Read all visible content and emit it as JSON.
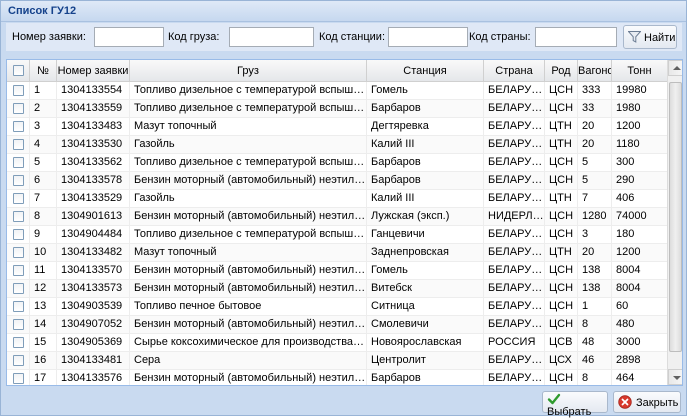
{
  "title": "Список ГУ12",
  "filter": {
    "request_label": "Номер заявки:",
    "cargo_label": "Код груза:",
    "station_label": "Код станции:",
    "country_label": "Код страны:",
    "request_value": "",
    "cargo_value": "",
    "station_value": "",
    "country_value": "",
    "find_label": "Найти",
    "find_icon": "funnel-icon"
  },
  "table": {
    "columns": [
      "№",
      "Номер заявки",
      "Груз",
      "Станция",
      "Страна",
      "Род",
      "Вагонов",
      "Тонн"
    ],
    "rows": [
      [
        "1",
        "1304133554",
        "Топливо дизельное с температурой вспышки вы…",
        "Гомель",
        "БЕЛАРУСЬ",
        "ЦСН",
        "333",
        "19980"
      ],
      [
        "2",
        "1304133559",
        "Топливо дизельное с температурой вспышки вы…",
        "Барбаров",
        "БЕЛАРУСЬ",
        "ЦСН",
        "33",
        "1980"
      ],
      [
        "3",
        "1304133483",
        "Мазут топочный",
        "Дегтяревка",
        "БЕЛАРУСЬ",
        "ЦТН",
        "20",
        "1200"
      ],
      [
        "4",
        "1304133530",
        "Газойль",
        "Калий III",
        "БЕЛАРУСЬ",
        "ЦТН",
        "20",
        "1180"
      ],
      [
        "5",
        "1304133562",
        "Топливо дизельное с температурой вспышки вы…",
        "Барбаров",
        "БЕЛАРУСЬ",
        "ЦСН",
        "5",
        "300"
      ],
      [
        "6",
        "1304133578",
        "Бензин моторный (автомобильный) неэтилирова…",
        "Барбаров",
        "БЕЛАРУСЬ",
        "ЦСН",
        "5",
        "290"
      ],
      [
        "7",
        "1304133529",
        "Газойль",
        "Калий III",
        "БЕЛАРУСЬ",
        "ЦТН",
        "7",
        "406"
      ],
      [
        "8",
        "1304901613",
        "Бензин моторный (автомобильный) неэтилирова…",
        "Лужская (эксп.)",
        "НИДЕРЛ…",
        "ЦСН",
        "1280",
        "74000"
      ],
      [
        "9",
        "1304904484",
        "Топливо дизельное с температурой вспышки вы…",
        "Ганцевичи",
        "БЕЛАРУСЬ",
        "ЦСН",
        "3",
        "180"
      ],
      [
        "10",
        "1304133482",
        "Мазут топочный",
        "Заднепровская",
        "БЕЛАРУСЬ",
        "ЦТН",
        "20",
        "1200"
      ],
      [
        "11",
        "1304133570",
        "Бензин моторный (автомобильный) неэтилирова…",
        "Гомель",
        "БЕЛАРУСЬ",
        "ЦСН",
        "138",
        "8004"
      ],
      [
        "12",
        "1304133573",
        "Бензин моторный (автомобильный) неэтилирова…",
        "Витебск",
        "БЕЛАРУСЬ",
        "ЦСН",
        "138",
        "8004"
      ],
      [
        "13",
        "1304903539",
        "Топливо печное бытовое",
        "Ситница",
        "БЕЛАРУСЬ",
        "ЦСН",
        "1",
        "60"
      ],
      [
        "14",
        "1304907052",
        "Бензин моторный (автомобильный) неэтилирова…",
        "Смолевичи",
        "БЕЛАРУСЬ",
        "ЦСН",
        "8",
        "480"
      ],
      [
        "15",
        "1304905369",
        "Сырье коксохимическое для производства техни…",
        "Новоярославская",
        "РОССИЯ",
        "ЦСВ",
        "48",
        "3000"
      ],
      [
        "16",
        "1304133481",
        "Сера",
        "Центролит",
        "БЕЛАРУСЬ",
        "ЦСХ",
        "46",
        "2898"
      ],
      [
        "17",
        "1304133576",
        "Бензин моторный (автомобильный) неэтилирова…",
        "Барбаров",
        "БЕЛАРУСЬ",
        "ЦСН",
        "8",
        "464"
      ]
    ]
  },
  "footer": {
    "select_label": "Выбрать",
    "select_icon": "check-icon",
    "close_label": "Закрыть",
    "close_icon": "close-icon"
  }
}
